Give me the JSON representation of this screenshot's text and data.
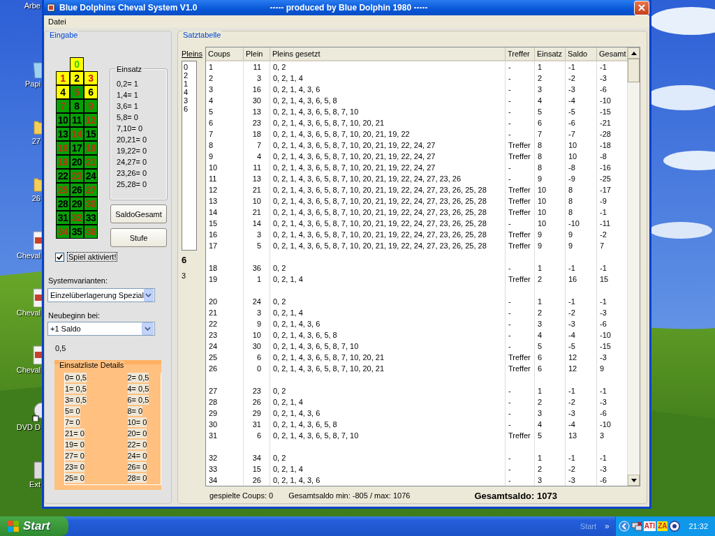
{
  "window": {
    "title": "Blue Dolphins Cheval System V1.0",
    "subtitle": "----- produced by Blue Dolphin 1980 -----"
  },
  "menu": [
    "Datei"
  ],
  "eingabe": {
    "title": "Eingabe",
    "roulette": [
      {
        "number": "0",
        "kind": "zero",
        "selected": true
      },
      {
        "number": "1",
        "kind": "red",
        "selected": true
      },
      {
        "number": "2",
        "kind": "black",
        "selected": true
      },
      {
        "number": "3",
        "kind": "red",
        "selected": true
      },
      {
        "number": "4",
        "kind": "black",
        "selected": true
      },
      {
        "number": "5",
        "kind": "red",
        "selected": false
      },
      {
        "number": "6",
        "kind": "black",
        "selected": true
      },
      {
        "number": "7",
        "kind": "red",
        "selected": false
      },
      {
        "number": "8",
        "kind": "black",
        "selected": false
      },
      {
        "number": "9",
        "kind": "red",
        "selected": false
      },
      {
        "number": "10",
        "kind": "black",
        "selected": false
      },
      {
        "number": "11",
        "kind": "black",
        "selected": false
      },
      {
        "number": "12",
        "kind": "red",
        "selected": false
      },
      {
        "number": "13",
        "kind": "black",
        "selected": false
      },
      {
        "number": "14",
        "kind": "red",
        "selected": false
      },
      {
        "number": "15",
        "kind": "black",
        "selected": false
      },
      {
        "number": "16",
        "kind": "red",
        "selected": false
      },
      {
        "number": "17",
        "kind": "black",
        "selected": false
      },
      {
        "number": "18",
        "kind": "red",
        "selected": false
      },
      {
        "number": "19",
        "kind": "red",
        "selected": false
      },
      {
        "number": "20",
        "kind": "black",
        "selected": false
      },
      {
        "number": "21",
        "kind": "red",
        "selected": false
      },
      {
        "number": "22",
        "kind": "black",
        "selected": false
      },
      {
        "number": "23",
        "kind": "red",
        "selected": false
      },
      {
        "number": "24",
        "kind": "black",
        "selected": false
      },
      {
        "number": "25",
        "kind": "red",
        "selected": false
      },
      {
        "number": "26",
        "kind": "black",
        "selected": false
      },
      {
        "number": "27",
        "kind": "red",
        "selected": false
      },
      {
        "number": "28",
        "kind": "black",
        "selected": false
      },
      {
        "number": "29",
        "kind": "black",
        "selected": false
      },
      {
        "number": "30",
        "kind": "red",
        "selected": false
      },
      {
        "number": "31",
        "kind": "black",
        "selected": false
      },
      {
        "number": "32",
        "kind": "red",
        "selected": false
      },
      {
        "number": "33",
        "kind": "black",
        "selected": false
      },
      {
        "number": "34",
        "kind": "red",
        "selected": false
      },
      {
        "number": "35",
        "kind": "black",
        "selected": false
      },
      {
        "number": "36",
        "kind": "red",
        "selected": false
      }
    ],
    "einsatz": {
      "title": "Einsatz",
      "items": [
        "0,2= 1",
        "1,4= 1",
        "3,6= 1",
        "5,8= 0",
        "7,10= 0",
        "20,21= 0",
        "19,22= 0",
        "24,27= 0",
        "23,26= 0",
        "25,28= 0"
      ]
    },
    "buttons": [
      "SaldoGesamt",
      "Stufe"
    ],
    "spiel": {
      "label": "Spiel aktiviert!",
      "checked": true
    },
    "systemvarianten": {
      "label": "Systemvarianten:",
      "value": "Einzelüberlagerung Spezial"
    },
    "neubeginn": {
      "label": "Neubeginn bei:",
      "value": "+1 Saldo"
    },
    "value": "0,5",
    "details": {
      "title": "Einsatzliste Details",
      "left": [
        "0= 0,5",
        "1= 0,5",
        "3= 0,5",
        "5= 0",
        "7= 0",
        "21= 0",
        "19= 0",
        "27= 0",
        "23= 0",
        "25= 0"
      ],
      "right": [
        "2= 0,5",
        "4= 0,5",
        "6= 0,5",
        "8= 0",
        "10= 0",
        "20= 0",
        "22= 0",
        "24= 0",
        "26= 0",
        "28= 0"
      ]
    }
  },
  "satztabelle": {
    "title": "Satztabelle",
    "pleins": {
      "header": "Pleins",
      "items": [
        "0",
        "2",
        "1",
        "4",
        "3",
        "6"
      ],
      "notes": [
        "6",
        "3"
      ]
    },
    "columns": [
      "Coups",
      "Plein",
      "Pleins gesetzt",
      "Treffer",
      "Einsatz",
      "Saldo",
      "Gesamt"
    ],
    "rows": [
      {
        "kind": "row",
        "cells": [
          "1",
          "11",
          "0, 2",
          "-",
          "1",
          "-1",
          "-1"
        ]
      },
      {
        "kind": "row",
        "cells": [
          "2",
          "3",
          "0, 2, 1, 4",
          "-",
          "2",
          "-2",
          "-3"
        ]
      },
      {
        "kind": "row",
        "cells": [
          "3",
          "16",
          "0, 2, 1, 4, 3, 6",
          "-",
          "3",
          "-3",
          "-6"
        ]
      },
      {
        "kind": "row",
        "cells": [
          "4",
          "30",
          "0, 2, 1, 4, 3, 6, 5, 8",
          "-",
          "4",
          "-4",
          "-10"
        ]
      },
      {
        "kind": "row",
        "cells": [
          "5",
          "13",
          "0, 2, 1, 4, 3, 6, 5, 8, 7, 10",
          "-",
          "5",
          "-5",
          "-15"
        ]
      },
      {
        "kind": "row",
        "cells": [
          "6",
          "23",
          "0, 2, 1, 4, 3, 6, 5, 8, 7, 10, 20, 21",
          "-",
          "6",
          "-6",
          "-21"
        ]
      },
      {
        "kind": "row",
        "cells": [
          "7",
          "18",
          "0, 2, 1, 4, 3, 6, 5, 8, 7, 10, 20, 21, 19, 22",
          "-",
          "7",
          "-7",
          "-28"
        ]
      },
      {
        "kind": "row",
        "cells": [
          "8",
          "7",
          "0, 2, 1, 4, 3, 6, 5, 8, 7, 10, 20, 21, 19, 22, 24, 27",
          "Treffer",
          "8",
          "10",
          "-18"
        ]
      },
      {
        "kind": "row",
        "cells": [
          "9",
          "4",
          "0, 2, 1, 4, 3, 6, 5, 8, 7, 10, 20, 21, 19, 22, 24, 27",
          "Treffer",
          "8",
          "10",
          "-8"
        ]
      },
      {
        "kind": "row",
        "cells": [
          "10",
          "11",
          "0, 2, 1, 4, 3, 6, 5, 8, 7, 10, 20, 21, 19, 22, 24, 27",
          "-",
          "8",
          "-8",
          "-16"
        ]
      },
      {
        "kind": "row",
        "cells": [
          "11",
          "13",
          "0, 2, 1, 4, 3, 6, 5, 8, 7, 10, 20, 21, 19, 22, 24, 27, 23, 26",
          "-",
          "9",
          "-9",
          "-25"
        ]
      },
      {
        "kind": "row",
        "cells": [
          "12",
          "21",
          "0, 2, 1, 4, 3, 6, 5, 8, 7, 10, 20, 21, 19, 22, 24, 27, 23, 26, 25, 28",
          "Treffer",
          "10",
          "8",
          "-17"
        ]
      },
      {
        "kind": "row",
        "cells": [
          "13",
          "10",
          "0, 2, 1, 4, 3, 6, 5, 8, 7, 10, 20, 21, 19, 22, 24, 27, 23, 26, 25, 28",
          "Treffer",
          "10",
          "8",
          "-9"
        ]
      },
      {
        "kind": "row",
        "cells": [
          "14",
          "21",
          "0, 2, 1, 4, 3, 6, 5, 8, 7, 10, 20, 21, 19, 22, 24, 27, 23, 26, 25, 28",
          "Treffer",
          "10",
          "8",
          "-1"
        ]
      },
      {
        "kind": "row",
        "cells": [
          "15",
          "14",
          "0, 2, 1, 4, 3, 6, 5, 8, 7, 10, 20, 21, 19, 22, 24, 27, 23, 26, 25, 28",
          "-",
          "10",
          "-10",
          "-11"
        ]
      },
      {
        "kind": "row",
        "cells": [
          "16",
          "3",
          "0, 2, 1, 4, 3, 6, 5, 8, 7, 10, 20, 21, 19, 22, 24, 27, 23, 26, 25, 28",
          "Treffer",
          "9",
          "9",
          "-2"
        ]
      },
      {
        "kind": "row",
        "cells": [
          "17",
          "5",
          "0, 2, 1, 4, 3, 6, 5, 8, 7, 10, 20, 21, 19, 22, 24, 27, 23, 26, 25, 28",
          "Treffer",
          "9",
          "9",
          "7"
        ]
      },
      {
        "kind": "blank"
      },
      {
        "kind": "row",
        "cells": [
          "18",
          "36",
          "0, 2",
          "-",
          "1",
          "-1",
          "-1"
        ]
      },
      {
        "kind": "row",
        "cells": [
          "19",
          "1",
          "0, 2, 1, 4",
          "Treffer",
          "2",
          "16",
          "15"
        ]
      },
      {
        "kind": "blank"
      },
      {
        "kind": "row",
        "cells": [
          "20",
          "24",
          "0, 2",
          "-",
          "1",
          "-1",
          "-1"
        ]
      },
      {
        "kind": "row",
        "cells": [
          "21",
          "3",
          "0, 2, 1, 4",
          "-",
          "2",
          "-2",
          "-3"
        ]
      },
      {
        "kind": "row",
        "cells": [
          "22",
          "9",
          "0, 2, 1, 4, 3, 6",
          "-",
          "3",
          "-3",
          "-6"
        ]
      },
      {
        "kind": "row",
        "cells": [
          "23",
          "10",
          "0, 2, 1, 4, 3, 6, 5, 8",
          "-",
          "4",
          "-4",
          "-10"
        ]
      },
      {
        "kind": "row",
        "cells": [
          "24",
          "30",
          "0, 2, 1, 4, 3, 6, 5, 8, 7, 10",
          "-",
          "5",
          "-5",
          "-15"
        ]
      },
      {
        "kind": "row",
        "cells": [
          "25",
          "6",
          "0, 2, 1, 4, 3, 6, 5, 8, 7, 10, 20, 21",
          "Treffer",
          "6",
          "12",
          "-3"
        ]
      },
      {
        "kind": "row",
        "cells": [
          "26",
          "0",
          "0, 2, 1, 4, 3, 6, 5, 8, 7, 10, 20, 21",
          "Treffer",
          "6",
          "12",
          "9"
        ]
      },
      {
        "kind": "blank"
      },
      {
        "kind": "row",
        "cells": [
          "27",
          "23",
          "0, 2",
          "-",
          "1",
          "-1",
          "-1"
        ]
      },
      {
        "kind": "row",
        "cells": [
          "28",
          "26",
          "0, 2, 1, 4",
          "-",
          "2",
          "-2",
          "-3"
        ]
      },
      {
        "kind": "row",
        "cells": [
          "29",
          "29",
          "0, 2, 1, 4, 3, 6",
          "-",
          "3",
          "-3",
          "-6"
        ]
      },
      {
        "kind": "row",
        "cells": [
          "30",
          "31",
          "0, 2, 1, 4, 3, 6, 5, 8",
          "-",
          "4",
          "-4",
          "-10"
        ]
      },
      {
        "kind": "row",
        "cells": [
          "31",
          "6",
          "0, 2, 1, 4, 3, 6, 5, 8, 7, 10",
          "Treffer",
          "5",
          "13",
          "3"
        ]
      },
      {
        "kind": "blank"
      },
      {
        "kind": "row",
        "cells": [
          "32",
          "34",
          "0, 2",
          "-",
          "1",
          "-1",
          "-1"
        ]
      },
      {
        "kind": "row",
        "cells": [
          "33",
          "15",
          "0, 2, 1, 4",
          "-",
          "2",
          "-2",
          "-3"
        ]
      },
      {
        "kind": "row",
        "cells": [
          "34",
          "26",
          "0, 2, 1, 4, 3, 6",
          "-",
          "3",
          "-3",
          "-6"
        ]
      }
    ]
  },
  "status_bar": {
    "coups": "gespielte Coups: 0",
    "range": "Gesamtsaldo min: -805 / max: 1076",
    "total": "Gesamtsaldo: 1073"
  },
  "desktop_icons": [
    {
      "label": "Arbe",
      "kind": "none"
    },
    {
      "label": "Papi",
      "kind": "bin"
    },
    {
      "label": "27",
      "kind": "folder"
    },
    {
      "label": "26",
      "kind": "folder"
    },
    {
      "label": "Cheval",
      "kind": "app"
    },
    {
      "label": "Cheval",
      "kind": "app"
    },
    {
      "label": "Cheval",
      "kind": "app"
    },
    {
      "label": "DVD D",
      "kind": "disc"
    },
    {
      "label": "Ext",
      "kind": "drive"
    }
  ],
  "taskbar": {
    "start": "Start",
    "toolbar": "Start",
    "chevron": "»",
    "tray_labels": [
      "ATI",
      "ZA"
    ],
    "clock": "21:32"
  }
}
